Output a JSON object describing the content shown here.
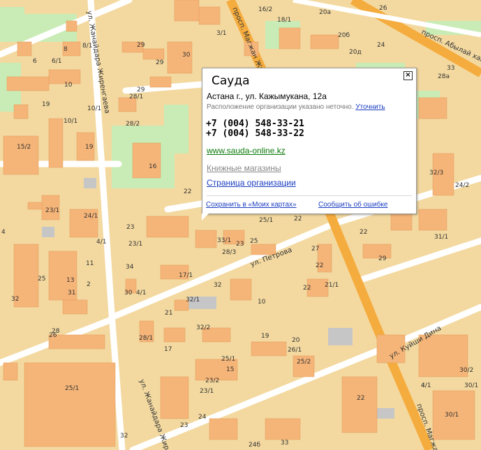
{
  "map": {
    "colors": {
      "background": "#f3d9a0",
      "building": "#f6b578",
      "green": "#c9ecb6",
      "road": "#ffffff",
      "main_road": "#f5ac3e",
      "gray": "#c6c6c6"
    },
    "streets": [
      {
        "name": "ул. Жанайдара Жиренгаева",
        "icon": "street-label"
      },
      {
        "name": "просп. Магжан Жумабаева",
        "icon": "street-label"
      },
      {
        "name": "просп. Абылай хана",
        "icon": "street-label"
      },
      {
        "name": "ул. Петрова",
        "icon": "street-label"
      },
      {
        "name": "ул. Куйши Дина",
        "icon": "street-label"
      },
      {
        "name": "ул. Жанайдара Жирен",
        "icon": "street-label"
      },
      {
        "name": "просп. Магжан",
        "icon": "street-label"
      }
    ],
    "house_numbers": [
      "16/2",
      "18/1",
      "20а",
      "3/1",
      "29",
      "30",
      "26",
      "20б",
      "20д",
      "24",
      "6",
      "6/1",
      "8/1",
      "8",
      "29",
      "29",
      "33",
      "28а",
      "10",
      "10/1",
      "28/1",
      "10/1",
      "19",
      "28/2",
      "15/2",
      "19",
      "16",
      "32/3",
      "24/2",
      "22",
      "23/1",
      "24/1",
      "23",
      "22",
      "4",
      "4/1",
      "33/1",
      "23/1",
      "25/1",
      "22",
      "31/1",
      "11",
      "28/3",
      "23",
      "25",
      "27",
      "29",
      "34",
      "2",
      "22",
      "25",
      "13",
      "31",
      "32",
      "21/1",
      "32",
      "30",
      "4/1",
      "17/1",
      "10",
      "22",
      "21",
      "32/1",
      "32/2",
      "26",
      "28",
      "28/1",
      "17",
      "19",
      "20",
      "26/1",
      "25/2",
      "25/1",
      "15",
      "23/2",
      "25/1",
      "23/1",
      "24",
      "22",
      "23",
      "4",
      "4/1",
      "30/2",
      "30/1",
      "30/1",
      "32",
      "33",
      "24б",
      "26/1",
      "26"
    ]
  },
  "popup": {
    "title": "Сауда",
    "address": "Астана г., ул. Кажымукана, 12а",
    "location_note": "Расположение организации указано неточно.",
    "refine_link": "Уточнить",
    "phones": [
      "+7 (004) 548-33-21",
      "+7 (004) 548-33-22"
    ],
    "website": "www.sauda-online.kz",
    "category": "Книжные магазины",
    "org_page": "Страница организации",
    "save_link": "Сохранить в «Моих картах»",
    "report_link": "Сообщить об ошибке",
    "close_icon": "close-icon"
  }
}
